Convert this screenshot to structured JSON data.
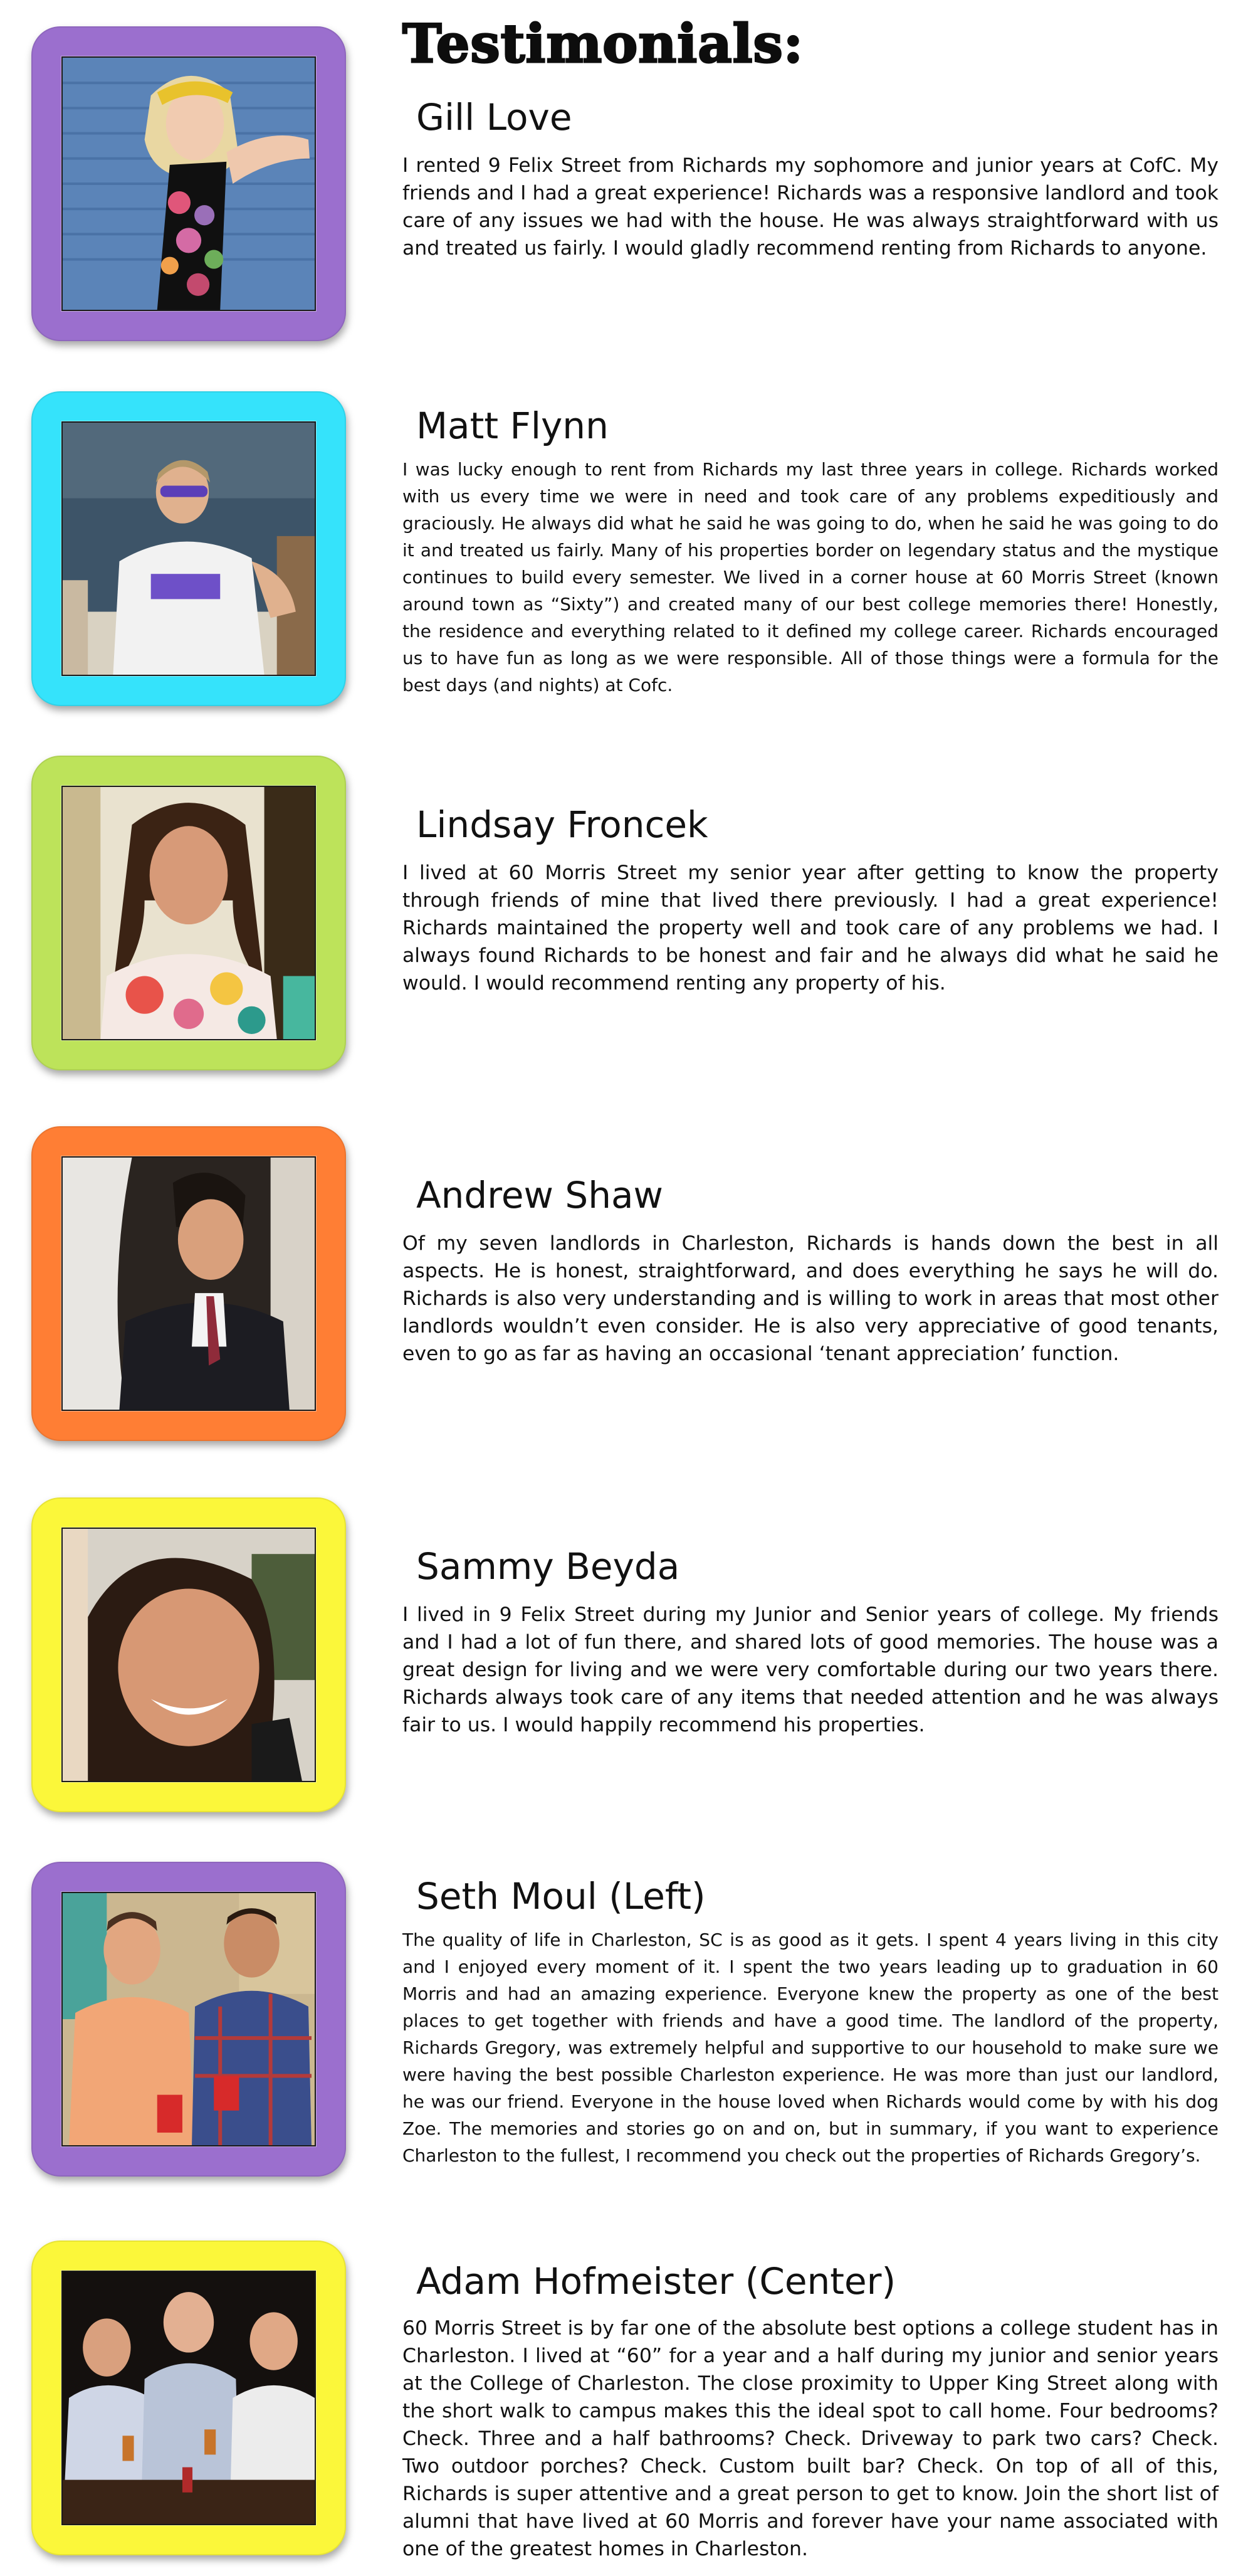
{
  "page": {
    "title": "Testimonials:"
  },
  "colors": {
    "purple": "#9b6fce",
    "cyan": "#35e3fb",
    "lime": "#bde35a",
    "orange": "#ff7e34",
    "yellow": "#fbf73a"
  },
  "testimonials": [
    {
      "name": "Gill Love",
      "frame_color": "#9b6fce",
      "photo_icon": "portrait-photo",
      "text": "I rented 9 Felix Street from Richards my sophomore and junior years at CofC. My friends and I had a great experience! Richards was a responsive landlord and took care of any issues we had with the house. He was always straightforward with us and treated us fairly. I would gladly recommend renting from Richards to anyone."
    },
    {
      "name": "Matt Flynn",
      "frame_color": "#35e3fb",
      "photo_icon": "portrait-photo",
      "text": "I was lucky enough to rent from Richards my last three years in college. Richards worked with us every time we were in need and took care of any problems expeditiously and graciously. He always did what he said he was going to do, when he said he was going to do it and treated us fairly. Many of his properties border on legendary status and the mystique continues to build every semester. We lived in a corner house at 60 Morris Street (known around town as “Sixty”) and created many of our best college memories there! Honestly, the residence and everything related to it defined my college career. Richards encouraged us to have fun as long as we were responsible. All of those things were a formula for the best days (and nights) at Cofc."
    },
    {
      "name": "Lindsay Froncek",
      "frame_color": "#bde35a",
      "photo_icon": "portrait-photo",
      "text": "I lived at 60 Morris Street my senior year after getting to know the property through friends of mine that lived there previously. I had a great experience! Richards maintained the property well and took care of any problems we had. I always found Richards to be honest and fair and he always did what he said he would. I would recommend renting any property of his."
    },
    {
      "name": "Andrew Shaw",
      "frame_color": "#ff7e34",
      "photo_icon": "portrait-photo",
      "text": "Of my seven landlords in Charleston, Richards is hands down the best in all aspects. He is honest, straightforward, and does everything he says he will do. Richards is also very understanding and is willing to work in areas that most other landlords wouldn’t even consider. He is also very appreciative of good tenants, even to go as far as having an occasional ‘tenant appreciation’ function."
    },
    {
      "name": "Sammy Beyda",
      "frame_color": "#fbf73a",
      "photo_icon": "portrait-photo",
      "text": "I lived in 9 Felix Street during my Junior and Senior years of college. My friends and I had a lot of fun there, and shared lots of good memories. The house was a great design for living and we were very comfortable during our two years there. Richards always took care of any items that needed attention and he was always fair to us. I would happily recommend his properties."
    },
    {
      "name": "Seth Moul (Left)",
      "frame_color": "#9b6fce",
      "photo_icon": "group-photo",
      "text": "The quality of life in Charleston, SC is as good as it gets. I spent 4 years living in this city and I enjoyed every moment of it. I spent the two years leading up to graduation in 60 Morris and had an amazing experience. Everyone knew the property as one of the best places to get together with friends and have a good time. The landlord of the property, Richards Gregory, was extremely helpful and supportive to our household to make sure we were having the best possible Charleston experience. He was more than just our landlord, he was our friend. Everyone in the house loved when Richards would come by with his dog Zoe. The memories and stories go on and on, but in summary, if you want to experience Charleston to the fullest, I recommend you check out the properties of Richards Gregory’s."
    },
    {
      "name": "Adam Hofmeister (Center)",
      "frame_color": "#fbf73a",
      "photo_icon": "group-photo",
      "text": "60 Morris Street is by far one of the absolute best options a college student has in Charleston. I lived at “60” for a year and a half during my junior and senior years at the College of Charleston. The close proximity to Upper King Street along with the short walk to campus makes this the ideal spot to call home. Four bedrooms? Check. Three and a half bathrooms? Check. Driveway to park two cars? Check. Two outdoor porches? Check. Custom built bar? Check. On top of all of this, Richards is super attentive and a great person to get to know. Join the short list of alumni that have lived at 60 Morris and forever have your name associated with one of the greatest homes in Charleston."
    }
  ]
}
